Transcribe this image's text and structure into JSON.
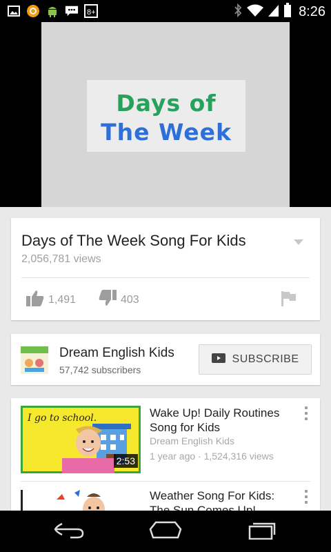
{
  "status_bar": {
    "time": "8:26",
    "left_icons": [
      "image-icon",
      "circle-app-icon",
      "android-icon",
      "chat-icon",
      "google-plus-icon"
    ],
    "right_icons": [
      "bluetooth-icon",
      "wifi-icon",
      "signal-icon",
      "battery-icon"
    ]
  },
  "player": {
    "thumbnail_line1": "Days of",
    "thumbnail_line2": "The Week"
  },
  "video": {
    "title": "Days of The Week Song For Kids",
    "views": "2,056,781 views",
    "likes": "1,491",
    "dislikes": "403"
  },
  "channel": {
    "name": "Dream English Kids",
    "subscribers": "57,742 subscribers",
    "subscribe_label": "SUBSCRIBE"
  },
  "related": [
    {
      "title": "Wake Up! Daily Routines Song for Kids",
      "channel": "Dream English Kids",
      "meta": "1 year ago · 1,524,316 views",
      "duration": "2:53",
      "thumb_text": "I go to school."
    },
    {
      "title": "Weather Song For Kids: The Sun Comes Up!",
      "channel": "",
      "meta": "",
      "duration": "",
      "thumb_text": ""
    }
  ],
  "colors": {
    "accent_blue": "#2e6fd8",
    "green_letter": "#27a25c",
    "red_letter": "#e0493f",
    "thumb_yellow": "#f6e82c",
    "thumb_green_border": "#3aa63a"
  }
}
